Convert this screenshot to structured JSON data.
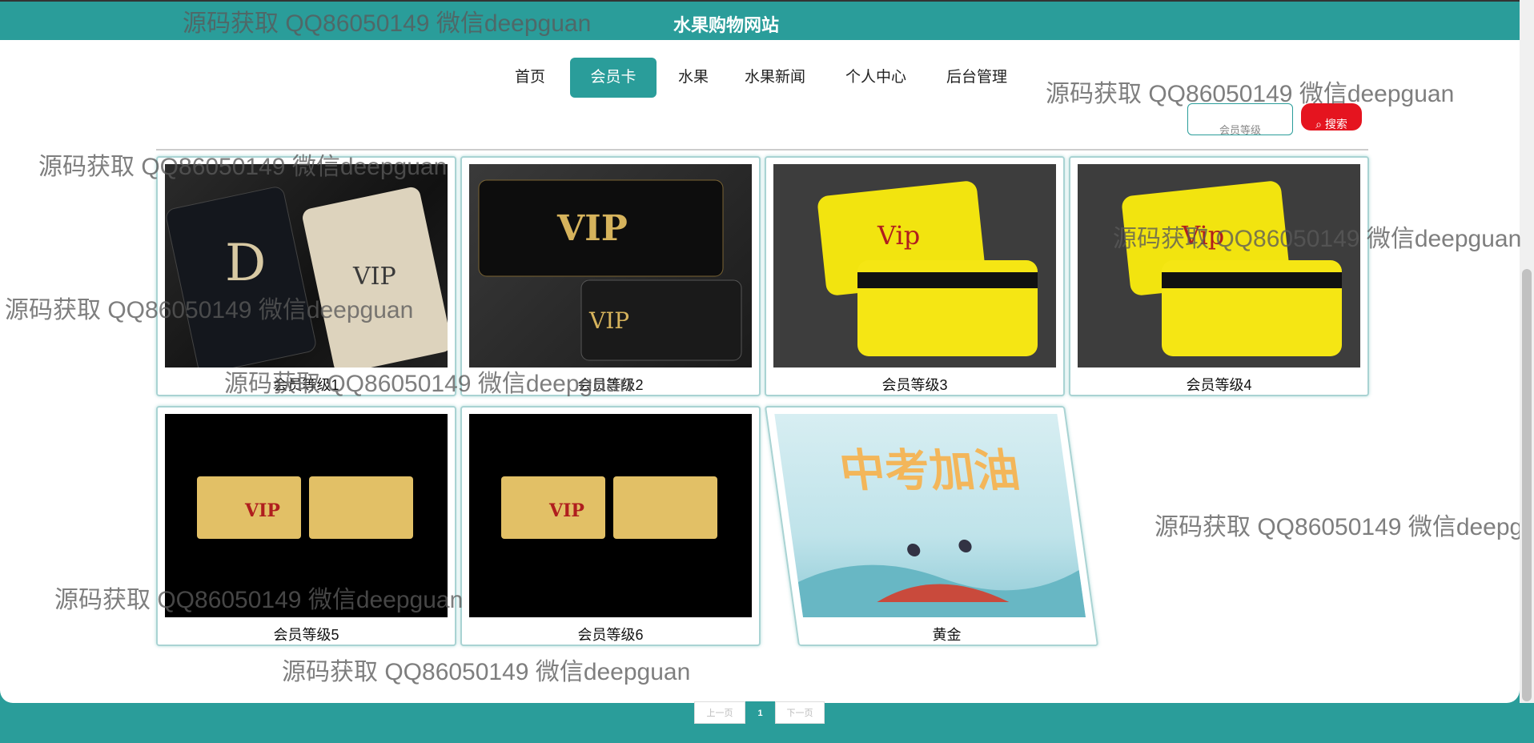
{
  "header": {
    "title": "水果购物网站"
  },
  "nav": [
    {
      "label": "首页"
    },
    {
      "label": "会员卡",
      "active": true
    },
    {
      "label": "水果"
    },
    {
      "label": "水果新闻"
    },
    {
      "label": "个人中心"
    },
    {
      "label": "后台管理"
    }
  ],
  "search": {
    "field_text": "会员等级",
    "button_label": "搜索"
  },
  "cards": [
    {
      "label": "会员等级1",
      "image_text": "VIP"
    },
    {
      "label": "会员等级2",
      "image_text": "VIP"
    },
    {
      "label": "会员等级3",
      "image_text": "Vip"
    },
    {
      "label": "会员等级4",
      "image_text": "Vip"
    },
    {
      "label": "会员等级5",
      "image_text": "VIP"
    },
    {
      "label": "会员等级6",
      "image_text": "VIP"
    },
    {
      "label": "黄金",
      "image_text": "中考加油"
    }
  ],
  "pagination": {
    "prev": "上一页",
    "current": "1",
    "next": "下一页"
  },
  "watermark": "源码获取 QQ86050149 微信deepguan",
  "colors": {
    "primary": "#2a9d9a",
    "search_button": "#e5141f"
  }
}
